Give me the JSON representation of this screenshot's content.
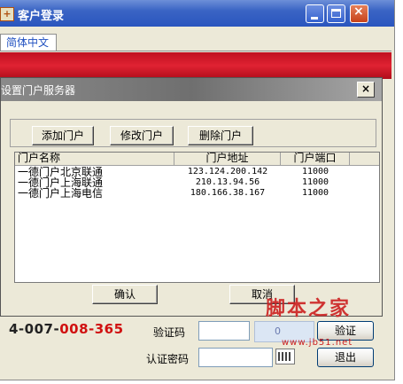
{
  "main_window": {
    "title": "客户登录",
    "language_tab": "简体中文",
    "hotline_part1": "4-007-",
    "hotline_part2": "008-365",
    "captcha_label": "验证码",
    "auth_password_label": "认证密码",
    "captcha_image_text": "0",
    "verify_button": "验证",
    "exit_button": "退出",
    "watermark_text": "脚本之家",
    "watermark_url": "www.jb51.net"
  },
  "dialog": {
    "title": "设置门户服务器",
    "close_label": "×",
    "toolbar": {
      "add_label": "添加门户",
      "edit_label": "修改门户",
      "delete_label": "删除门户"
    },
    "list": {
      "columns": [
        "门户名称",
        "门户地址",
        "门户端口"
      ],
      "rows": [
        {
          "name": "一德门户北京联通",
          "address": "123.124.200.142",
          "port": "11000"
        },
        {
          "name": "一德门户上海联通",
          "address": "210.13.94.56",
          "port": "11000"
        },
        {
          "name": "一德门户上海电信",
          "address": "180.166.38.167",
          "port": "11000"
        }
      ]
    },
    "confirm_label": "确认",
    "cancel_label": "取消"
  },
  "icons": {
    "app": "app-logo-icon",
    "minimize": "minimize-icon",
    "maximize": "maximize-icon",
    "close": "close-icon",
    "keyboard": "keyboard-icon"
  },
  "colors": {
    "title_bar": "#2a55be",
    "banner": "#e02232",
    "dialog_title_bar": "#7a7a7a",
    "hotline_red": "#d01010"
  }
}
